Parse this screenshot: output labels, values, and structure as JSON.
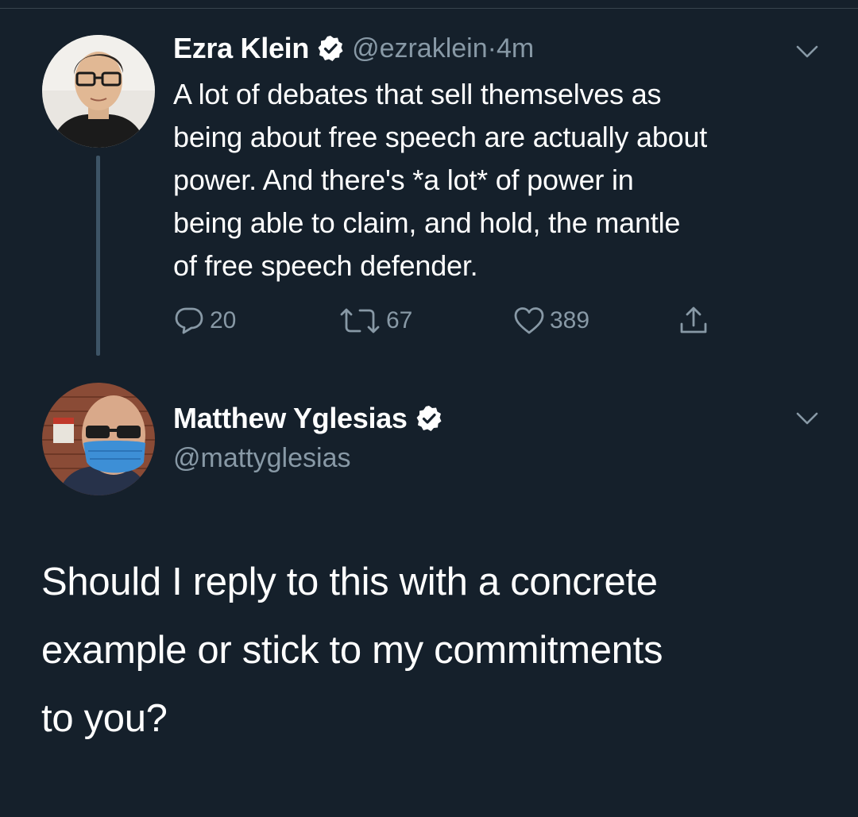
{
  "original_tweet": {
    "display_name": "Ezra Klein",
    "handle": "@ezraklein",
    "separator": " · ",
    "time": "4m",
    "text_lines": [
      "A lot of debates that sell themselves as",
      "being about free speech are actually about",
      "power. And there's *a lot* of power in",
      "being able to claim, and hold, the mantle",
      "of free speech defender."
    ],
    "actions": {
      "reply_count": "20",
      "retweet_count": "67",
      "like_count": "389"
    }
  },
  "reply_tweet": {
    "display_name": "Matthew Yglesias",
    "handle": "@mattyglesias",
    "text_lines": [
      "Should I reply to this with a concrete",
      "example or stick to my commitments",
      "to you?"
    ]
  },
  "icons": {
    "verified": "verified-badge-icon",
    "chevron": "chevron-down-icon",
    "reply": "reply-icon",
    "retweet": "retweet-icon",
    "like": "heart-icon",
    "share": "share-icon"
  },
  "colors": {
    "background": "#15202b",
    "secondary_text": "#8899a6",
    "thread_line": "#3d5466"
  }
}
